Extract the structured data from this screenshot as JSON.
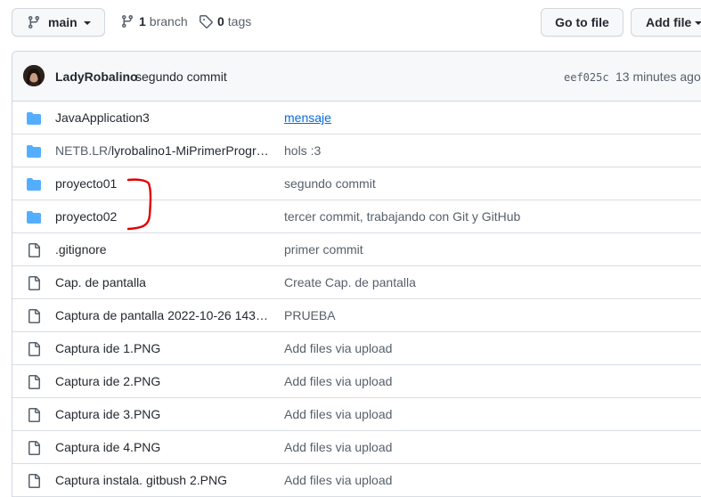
{
  "toolbar": {
    "branch_label": "main",
    "branches_count": "1",
    "branches_label": "branch",
    "tags_count": "0",
    "tags_label": "tags",
    "goto_file_label": "Go to file",
    "add_file_label": "Add file"
  },
  "commit": {
    "author": "LadyRobalino",
    "message": "segundo commit",
    "sha": "eef025c",
    "time_ago": "13 minutes ago"
  },
  "files": [
    {
      "type": "folder",
      "name": "JavaApplication3",
      "message": "mensaje",
      "message_link": true
    },
    {
      "type": "folder",
      "name_prefix": "NETB.LR/",
      "name": "lyrobalino1-MiPrimerProgra…",
      "message": "hols :3"
    },
    {
      "type": "folder",
      "name": "proyecto01",
      "message": "segundo commit"
    },
    {
      "type": "folder",
      "name": "proyecto02",
      "message": "tercer commit, trabajando con Git y GitHub"
    },
    {
      "type": "file",
      "name": ".gitignore",
      "message": "primer commit"
    },
    {
      "type": "file",
      "name": "Cap. de pantalla",
      "message": "Create Cap. de pantalla"
    },
    {
      "type": "file",
      "name": "Captura de pantalla 2022-10-26 143…",
      "message": "PRUEBA"
    },
    {
      "type": "file",
      "name": "Captura ide 1.PNG",
      "message": "Add files via upload"
    },
    {
      "type": "file",
      "name": "Captura ide 2.PNG",
      "message": "Add files via upload"
    },
    {
      "type": "file",
      "name": "Captura ide 3.PNG",
      "message": "Add files via upload"
    },
    {
      "type": "file",
      "name": "Captura ide 4.PNG",
      "message": "Add files via upload"
    },
    {
      "type": "file",
      "name": "Captura instala. gitbush 2.PNG",
      "message": "Add files via upload"
    }
  ],
  "colors": {
    "folder": "#54aeff",
    "file_icon": "#57606a",
    "link": "#0969da",
    "annotation": "#e00000"
  },
  "icons": {
    "branch": "git-branch-icon",
    "tag": "tag-icon",
    "folder": "folder-icon",
    "file": "file-icon"
  }
}
